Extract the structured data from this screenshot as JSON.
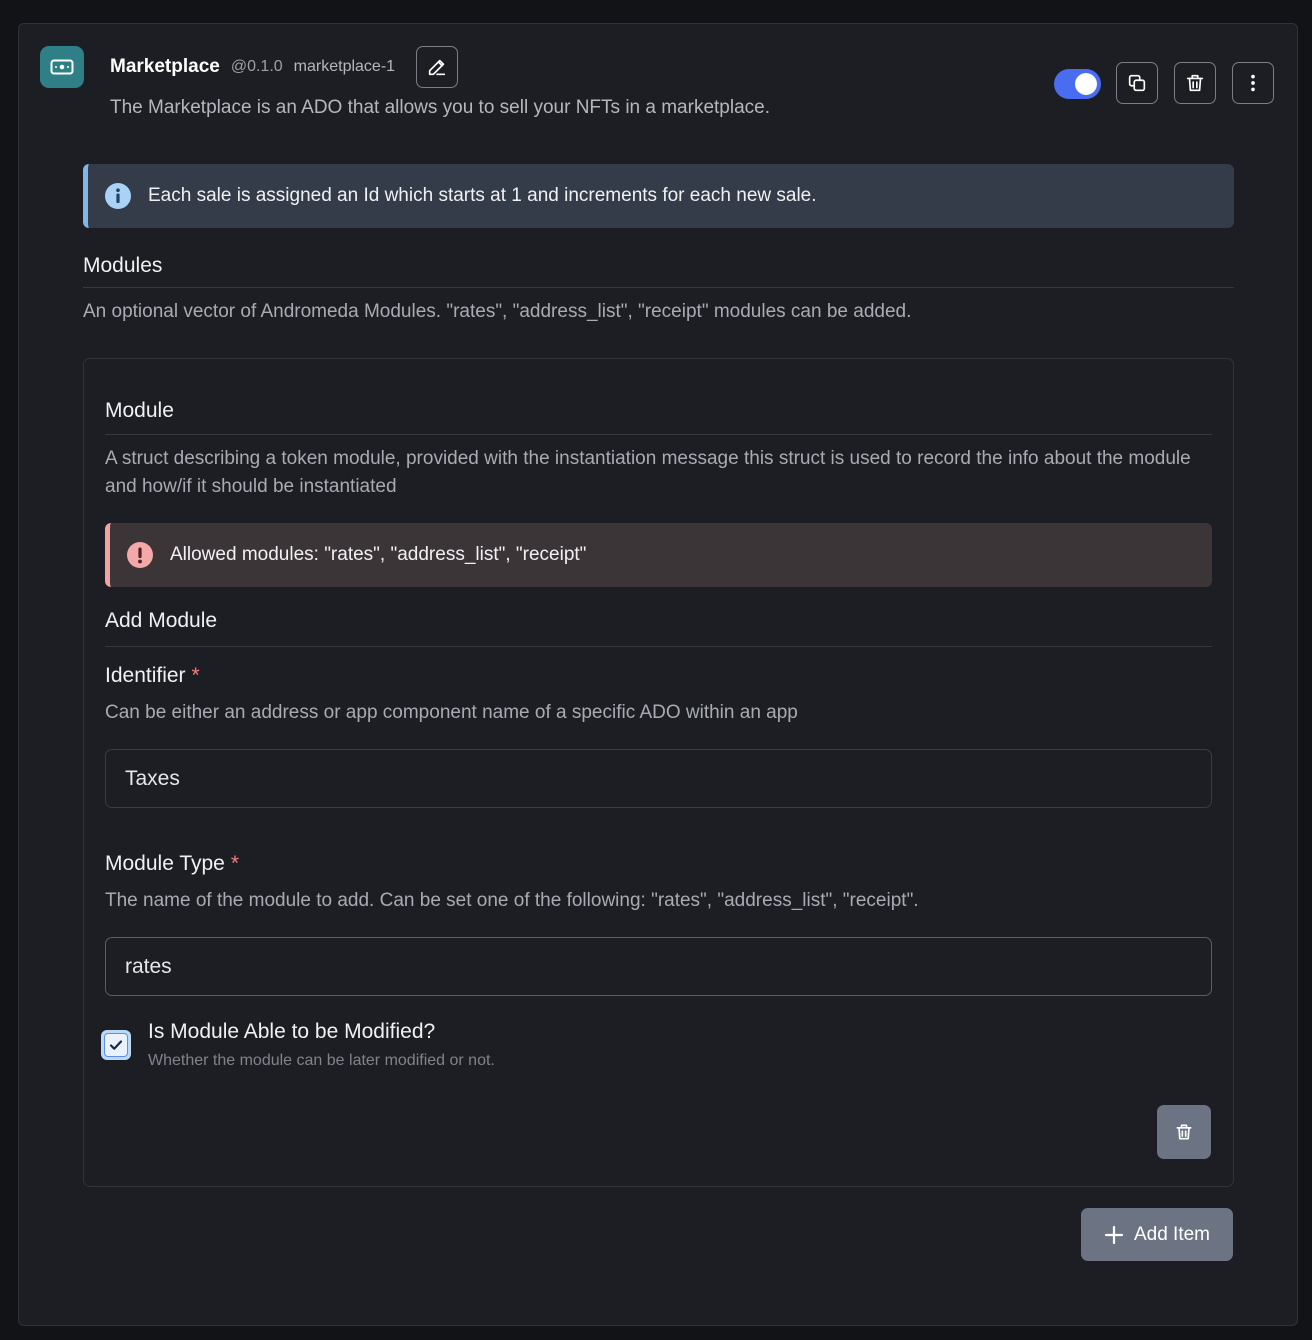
{
  "header": {
    "title": "Marketplace",
    "version": "@0.1.0",
    "instance_name": "marketplace-1",
    "description": "The Marketplace is an ADO that allows you to sell your NFTs in a marketplace.",
    "enabled": true,
    "icons": {
      "ado": "money-bill-icon",
      "edit": "pencil-icon",
      "copy": "copy-icon",
      "delete": "trash-icon",
      "more": "vertical-ellipsis-icon"
    }
  },
  "info_banner": {
    "icon": "info-icon",
    "text": "Each sale is assigned an Id which starts at 1 and increments for each new sale."
  },
  "modules": {
    "title": "Modules",
    "description": "An optional vector of Andromeda Modules. \"rates\", \"address_list\", \"receipt\" modules can be added.",
    "module": {
      "title": "Module",
      "description": "A struct describing a token module, provided with the instantiation message this struct is used to record the info about the module and how/if it should be instantiated",
      "warning": {
        "icon": "exclamation-icon",
        "text": "Allowed modules: \"rates\", \"address_list\", \"receipt\""
      },
      "add_module_title": "Add Module",
      "identifier": {
        "label": "Identifier",
        "required_mark": "*",
        "help": "Can be either an address or app component name of a specific ADO within an app",
        "value": "Taxes"
      },
      "module_type": {
        "label": "Module Type",
        "required_mark": "*",
        "help": "The name of the module to add. Can be set one of the following: \"rates\", \"address_list\", \"receipt\".",
        "value": "rates"
      },
      "is_mutable": {
        "label": "Is Module Able to be Modified?",
        "help": "Whether the module can be later modified or not.",
        "checked": true
      }
    },
    "add_item_label": "Add Item"
  },
  "colors": {
    "accent": "#4a6cf0",
    "info_border": "#7fb8e8",
    "warning_border": "#f2a3a3",
    "ado_icon_bg": "#2f7f87",
    "button_gray": "#6c7484"
  }
}
